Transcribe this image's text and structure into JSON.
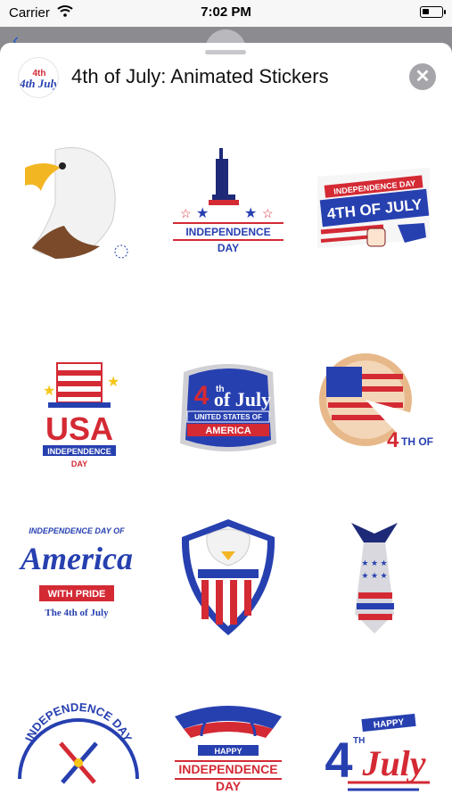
{
  "status_bar": {
    "carrier": "Carrier",
    "time": "7:02 PM"
  },
  "app": {
    "title": "4th of July: Animated Stickers",
    "icon_label": "4th July"
  },
  "colors": {
    "red": "#d42a34",
    "blue": "#2740b0",
    "navy": "#1e2a78",
    "star_yellow": "#f5c518"
  },
  "stickers": [
    {
      "name": "eagle",
      "texts": []
    },
    {
      "name": "liberty-independence-day",
      "texts": [
        "INDEPENDENCE",
        "DAY"
      ]
    },
    {
      "name": "4th-of-july-fist",
      "texts": [
        "INDEPENDENCE DAY",
        "4TH OF JULY"
      ]
    },
    {
      "name": "usa-hat",
      "texts": [
        "USA",
        "INDEPENDENCE",
        "DAY"
      ]
    },
    {
      "name": "4th-of-july-badge",
      "texts": [
        "4",
        "th",
        "of July",
        "UNITED STATES OF",
        "AMERICA"
      ]
    },
    {
      "name": "flag-pie",
      "texts": [
        "4",
        "TH OF"
      ]
    },
    {
      "name": "america-with-pride",
      "texts": [
        "INDEPENDENCE DAY OF",
        "America",
        "WITH PRIDE",
        "The 4th of July"
      ]
    },
    {
      "name": "eagle-shield",
      "texts": []
    },
    {
      "name": "flag-tie",
      "texts": []
    },
    {
      "name": "independence-day-arch",
      "texts": [
        "INDEPENDENCE DAY"
      ]
    },
    {
      "name": "happy-independence-day",
      "texts": [
        "HAPPY",
        "INDEPENDENCE",
        "DAY"
      ]
    },
    {
      "name": "happy-4th-july",
      "texts": [
        "HAPPY",
        "4",
        "TH",
        "July"
      ]
    }
  ]
}
